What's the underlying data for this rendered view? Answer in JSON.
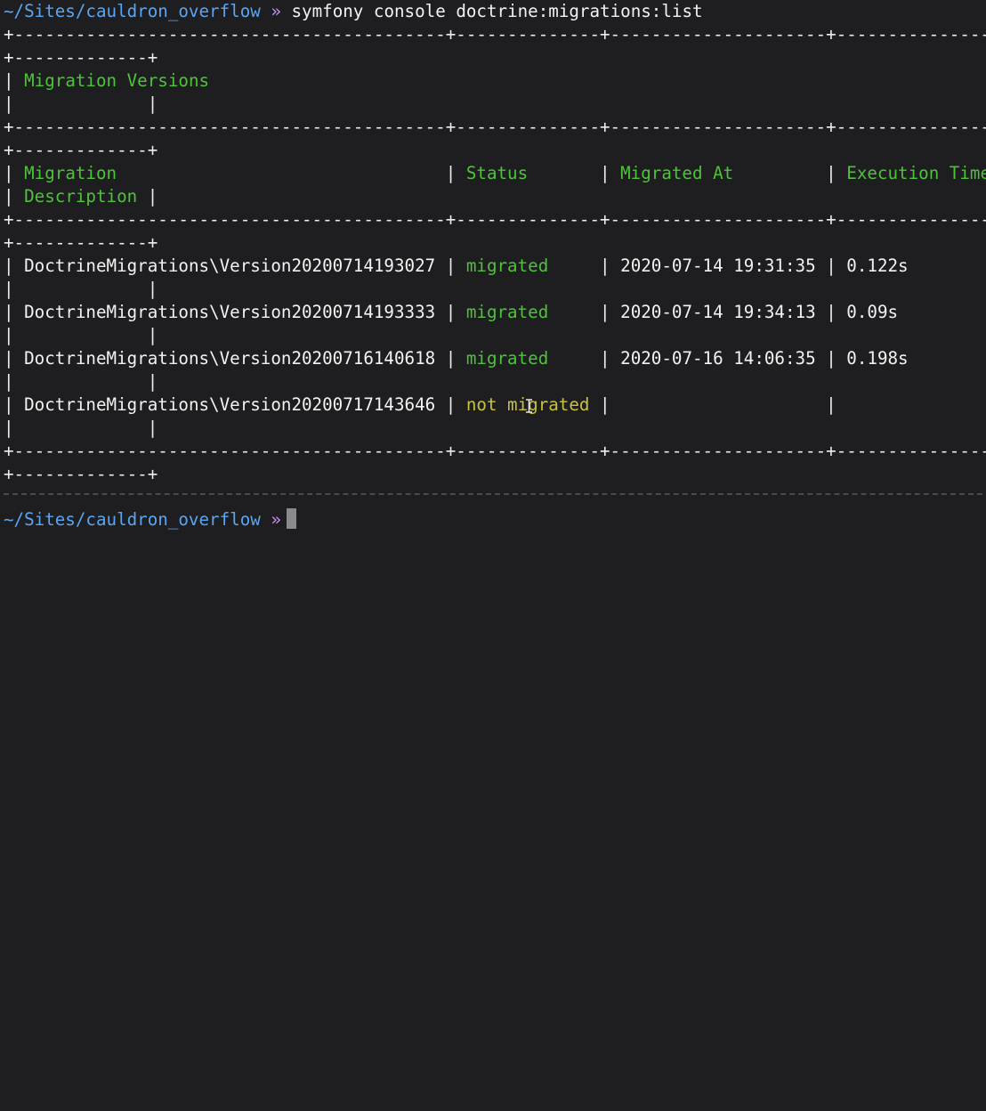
{
  "terminal": {
    "prompt_path": "~/Sites/cauldron_overflow",
    "prompt_arrow": "»",
    "command": "symfony console doctrine:migrations:list",
    "border_full": "+------------------------------------------+--------------+---------------------+-----------------",
    "border_tail": "+-------------+",
    "title_prefix": "| ",
    "title": "Migration Versions",
    "wrap_bar_line": "|             |",
    "header": {
      "migration": "Migration",
      "status": "Status",
      "migrated_at": "Migrated At",
      "execution_time": "Execution Time",
      "description": "Description"
    },
    "rows": [
      {
        "migration": "DoctrineMigrations\\Version20200714193027",
        "status": "migrated",
        "migrated_at": "2020-07-14 19:31:35",
        "execution_time": "0.122s"
      },
      {
        "migration": "DoctrineMigrations\\Version20200714193333",
        "status": "migrated",
        "migrated_at": "2020-07-14 19:34:13",
        "execution_time": "0.09s"
      },
      {
        "migration": "DoctrineMigrations\\Version20200716140618",
        "status": "migrated",
        "migrated_at": "2020-07-16 14:06:35",
        "execution_time": "0.198s"
      },
      {
        "migration": "DoctrineMigrations\\Version20200717143646",
        "status": "not migrated",
        "migrated_at": "",
        "execution_time": ""
      }
    ]
  }
}
